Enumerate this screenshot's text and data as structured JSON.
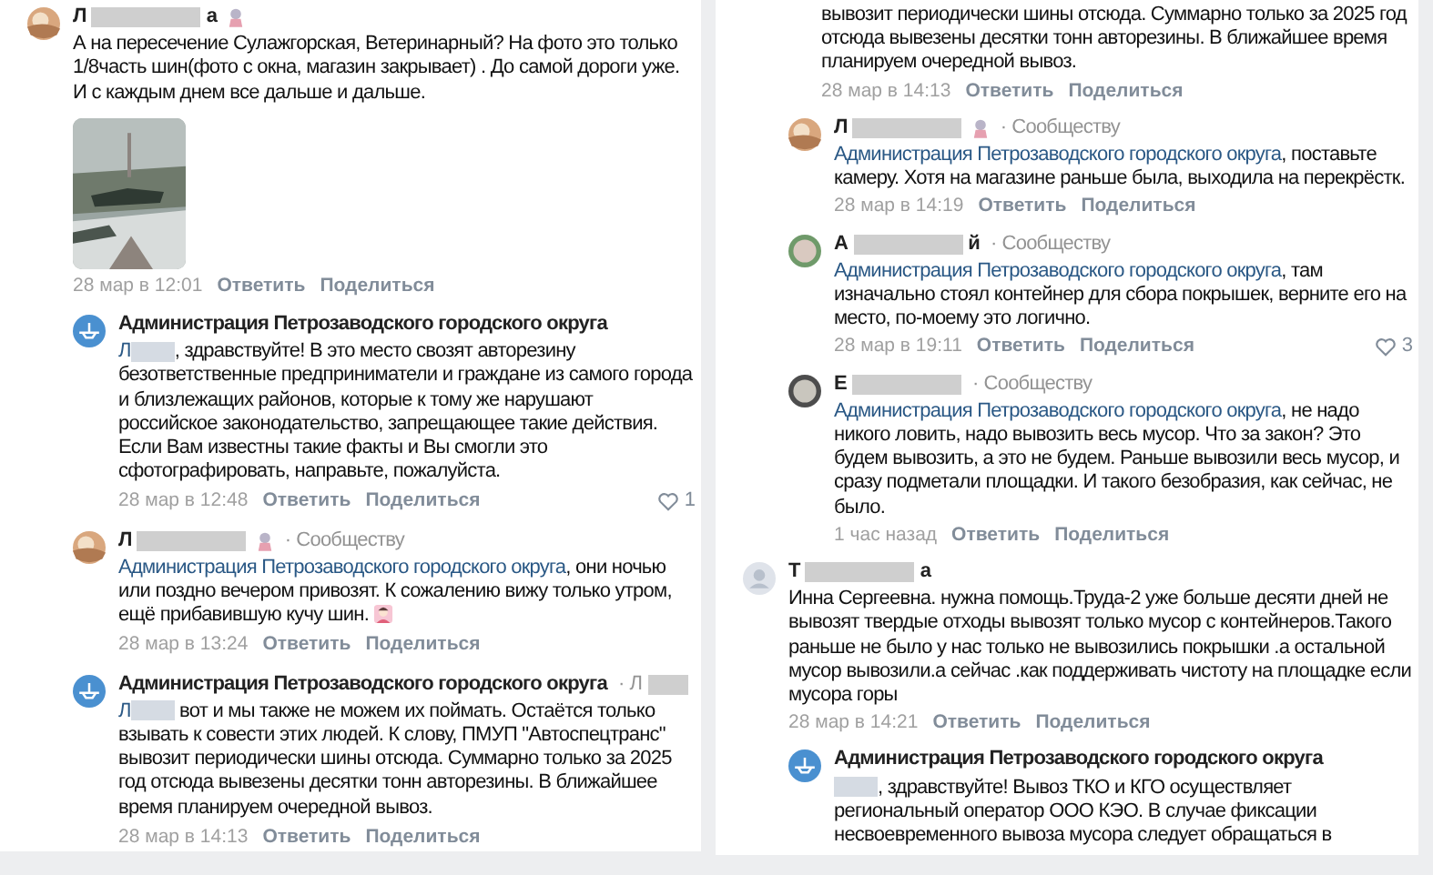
{
  "columns": [
    {
      "comments": [
        {
          "kind": "top",
          "name": {
            "start": "Л",
            "end": "а"
          },
          "badge": true,
          "body": {
            "text": "А на пересечение Сулажгорская, Ветеринарный? На фото это только 1/8часть шин(фото с окна, магазин закрывает) . До самой дороги уже. И с каждым днем все дальше и дальше."
          },
          "time": "28 мар в 12:01",
          "reply": "Ответить",
          "share": "Поделиться"
        },
        {
          "kind": "reply",
          "avatar": {
            "kind": "admin"
          },
          "name": {
            "start": "Администрация Петрозаводского городского округа"
          },
          "badge": false,
          "body": {
            "mention": {
              "start": "Л",
              "redacted": true
            },
            "text": ", здравствуйте! В это место свозят авторезину безответственные предприниматели и граждане из самого города и близлежащих районов, которые к тому же нарушают российское законодательство, запрещающее такие действия. Если Вам известны такие факты и Вы смогли это сфотографировать, направьте, пожалуйста."
          },
          "time": "28 мар в 12:48",
          "reply": "Ответить",
          "share": "Поделиться",
          "likes": "1"
        },
        {
          "kind": "reply",
          "name": {
            "start": "Л"
          },
          "badge": true,
          "to": {
            "separator": "·",
            "text": "Сообществу",
            "redacted": false
          },
          "body": {
            "mention": {
              "start": "Администрация Петрозаводского городского округа",
              "redacted": false
            },
            "text": ", они ночью или поздно вечером привозят. К сожалению вижу только утром, ещё прибавившую кучу шин.",
            "emoji": true
          },
          "time": "28 мар в 13:24",
          "reply": "Ответить",
          "share": "Поделиться"
        },
        {
          "kind": "reply",
          "avatar": {
            "kind": "admin"
          },
          "name": {
            "start": "Администрация Петрозаводского городского округа"
          },
          "badge": false,
          "to": {
            "separator": "·",
            "text": "Л",
            "redacted": true
          },
          "body": {
            "mention": {
              "start": "Л",
              "redacted": true
            },
            "text": " вот и мы также не можем их поймать. Остаётся только взывать к совести этих людей. К слову, ПМУП \"Автоспецтранс\" вывозит периодически шины отсюда. Суммарно только за 2025 год отсюда вывезены десятки тонн авторезины. В ближайшее время планируем очередной вывоз."
          },
          "time": "28 мар в 14:13",
          "reply": "Ответить",
          "share": "Поделиться"
        }
      ]
    },
    {
      "comments": [
        {
          "kind": "continuation",
          "body": {
            "text": "вывозит периодически шины отсюда. Суммарно только за 2025 год отсюда вывезены десятки тонн авторезины. В ближайшее время планируем очередной вывоз."
          },
          "time": "28 мар в 14:13",
          "reply": "Ответить",
          "share": "Поделиться"
        },
        {
          "kind": "reply",
          "name": {
            "start": "Л"
          },
          "badge": true,
          "to": {
            "separator": "·",
            "text": "Сообществу",
            "redacted": false
          },
          "body": {
            "mention": {
              "start": "Администрация Петрозаводского городского округа",
              "redacted": false
            },
            "text": ", поставьте камеру. Хотя на магазине раньше была, выходила на перекрёстк."
          },
          "time": "28 мар в 14:19",
          "reply": "Ответить",
          "share": "Поделиться"
        },
        {
          "kind": "reply",
          "avatar": {
            "kind": "green"
          },
          "name": {
            "start": "А",
            "end": "й"
          },
          "badge": false,
          "to": {
            "separator": "·",
            "text": "Сообществу",
            "redacted": false
          },
          "body": {
            "mention": {
              "start": "Администрация Петрозаводского городского округа",
              "redacted": false
            },
            "text": ", там изначально стоял контейнер для сбора покрышек, верните его на место, по-моему это логично."
          },
          "time": "28 мар в 19:11",
          "reply": "Ответить",
          "share": "Поделиться",
          "likes": "3"
        },
        {
          "kind": "reply",
          "avatar": {
            "kind": "gray"
          },
          "name": {
            "start": "Е"
          },
          "badge": false,
          "to": {
            "separator": "·",
            "text": "Сообществу",
            "redacted": false
          },
          "body": {
            "mention": {
              "start": "Администрация Петрозаводского городского округа",
              "redacted": false
            },
            "text": ", не надо никого ловить, надо вывозить весь мусор. Что за закон? Это будем вывозить, а это не будем. Раньше вывозили весь мусор, и сразу подметали площадки. И такого безобразия, как сейчас, не было."
          },
          "time": "1 час назад",
          "reply": "Ответить",
          "share": "Поделиться"
        },
        {
          "kind": "top",
          "avatar": {
            "kind": "placeholder"
          },
          "name": {
            "start": "Т",
            "end": "а"
          },
          "badge": false,
          "body": {
            "text": "Инна Сергеевна. нужна помощь.Труда-2 уже больше десяти дней не вывозят твердые отходы вывозят только мусор с контейнеров.Такого раньше не было у нас только не вывозились покрышки .а остальной мусор вывозили.а сейчас .как поддерживать чистоту на площадке если мусора горы"
          },
          "time": "28 мар в 14:21",
          "reply": "Ответить",
          "share": "Поделиться"
        },
        {
          "kind": "reply",
          "avatar": {
            "kind": "admin"
          },
          "name": {
            "start": "Администрация Петрозаводского городского округа"
          },
          "badge": false,
          "body": {
            "mention": {
              "redacted": true
            },
            "text": ", здравствуйте! Вывоз ТКО и КГО осуществляет региональный оператор ООО КЭО. В случае фиксации несвоевременного вывоза мусора следует обращаться в"
          }
        }
      ]
    }
  ]
}
